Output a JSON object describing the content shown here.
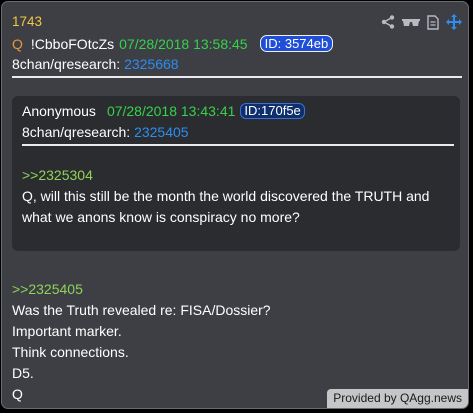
{
  "post": {
    "number": "1743",
    "q_label": "Q",
    "tripcode": "!CbboFOtcZs",
    "date": "07/28/2018 13:58:45",
    "id_badge": "ID: 3574eb",
    "board": "8chan/qresearch:",
    "post_link": "2325668"
  },
  "quoted": {
    "author": "Anonymous",
    "date": "07/28/2018 13:43:41",
    "id_badge": "ID:170f5e",
    "board": "8chan/qresearch:",
    "post_link": "2325405",
    "reply_ref": ">>2325304",
    "text": "Q, will this still be the month the world discovered the TRUTH and what we anons know is conspiracy no more?"
  },
  "body": {
    "reply_ref": ">>2325405",
    "lines": [
      "Was the Truth revealed re: FISA/Dossier?",
      "Important marker.",
      "Think connections.",
      "D5.",
      "Q"
    ]
  },
  "footer": {
    "credit": "Provided by QAgg.news"
  },
  "icons": [
    "share-icon",
    "glasses-icon",
    "document-icon",
    "move-icon"
  ],
  "colors": {
    "post_number": "#f3c742",
    "date": "#35d24b",
    "link": "#2d8df0",
    "greentext": "#8ed35a",
    "id_badge": "#1e4fd6",
    "q_label": "#e8963a"
  }
}
